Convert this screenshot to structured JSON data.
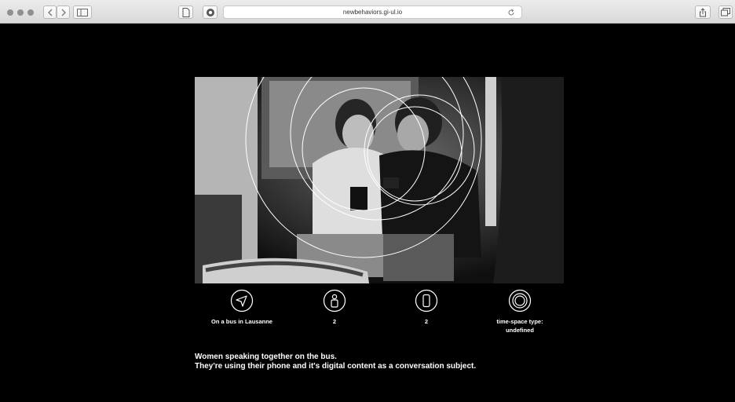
{
  "browser": {
    "url": "newbehaviors.gi-ul.io"
  },
  "meta": {
    "location": "On a bus in Lausanne",
    "people_count": "2",
    "devices_count": "2",
    "time_space_line1": "time-space type:",
    "time_space_line2": "undefined"
  },
  "description": {
    "line1": "Women speaking together on the bus.",
    "line2": "They're using their phone and it's digital content as a conversation subject."
  },
  "icons": {
    "location": "navigation-arrow-icon",
    "people": "person-icon",
    "devices": "phone-icon",
    "time_space": "concentric-circles-icon"
  },
  "colors": {
    "background": "#000000",
    "text": "#ffffff"
  }
}
